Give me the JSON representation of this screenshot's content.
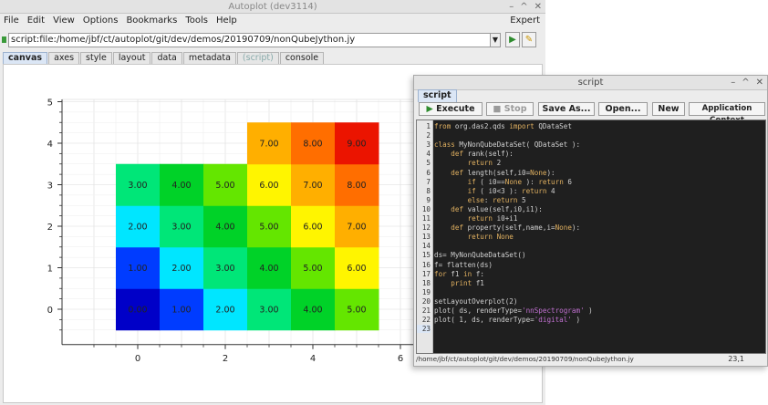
{
  "main_window": {
    "title": "Autoplot (dev3114)",
    "menu": [
      "File",
      "Edit",
      "View",
      "Options",
      "Bookmarks",
      "Tools",
      "Help"
    ],
    "expert_label": "Expert",
    "url": "script:file:/home/jbf/ct/autoplot/git/dev/demos/20190709/nonQubeJython.jy",
    "tabs": [
      "canvas",
      "axes",
      "style",
      "layout",
      "data",
      "metadata",
      "(script)",
      "console"
    ],
    "active_tab": "canvas"
  },
  "chart_data": {
    "type": "heatmap",
    "title": "",
    "xlabel": "",
    "ylabel": "",
    "x_ticks": [
      "0",
      "2",
      "4",
      "6"
    ],
    "y_ticks": [
      "0",
      "1",
      "2",
      "3",
      "4",
      "5"
    ],
    "xlim": [
      -1.25,
      6.0
    ],
    "ylim": [
      -0.5,
      5.0
    ],
    "colorscale": "rainbow",
    "datasets": [
      {
        "name": "ds",
        "rows": [
          {
            "y": 0,
            "x_start": -0.5,
            "values": [
              0,
              1,
              2,
              3,
              4,
              5
            ]
          },
          {
            "y": 1,
            "x_start": -0.5,
            "values": [
              1,
              2,
              3,
              4,
              5,
              6
            ]
          },
          {
            "y": 2,
            "x_start": -0.5,
            "values": [
              2,
              3,
              4,
              5,
              6,
              7
            ]
          },
          {
            "y": 3,
            "x_start": -0.5,
            "values": [
              3,
              4,
              5,
              6,
              7,
              8
            ]
          },
          {
            "y": 4,
            "x_start": 2.5,
            "values": [
              7,
              8,
              9
            ]
          }
        ]
      }
    ],
    "value_format": "0.00"
  },
  "script_window": {
    "title": "script",
    "tab": "script",
    "buttons": {
      "execute": "Execute",
      "stop": "Stop",
      "save_as": "Save As...",
      "open": "Open...",
      "new": "New",
      "app_context": "Application Context"
    },
    "code_lines": [
      "from org.das2.qds import QDataSet",
      "",
      "class MyNonQubeDataSet( QDataSet ):",
      "    def rank(self):",
      "        return 2",
      "    def length(self,i0=None):",
      "        if ( i0==None ): return 6",
      "        if ( i0<3 ): return 4",
      "        else: return 5",
      "    def value(self,i0,i1):",
      "        return i0+i1",
      "    def property(self,name,i=None):",
      "        return None",
      "",
      "ds= MyNonQubeDataSet()",
      "f= flatten(ds)",
      "for f1 in f:",
      "    print f1",
      "",
      "setLayoutOverplot(2)",
      "plot( ds, renderType='nnSpectrogram' )",
      "plot( 1, ds, renderType='digital' )",
      ""
    ],
    "current_line": 23,
    "status_path": "/home/jbf/ct/autoplot/git/dev/demos/20190709/nonQubeJython.jy",
    "cursor_pos": "23,1"
  }
}
